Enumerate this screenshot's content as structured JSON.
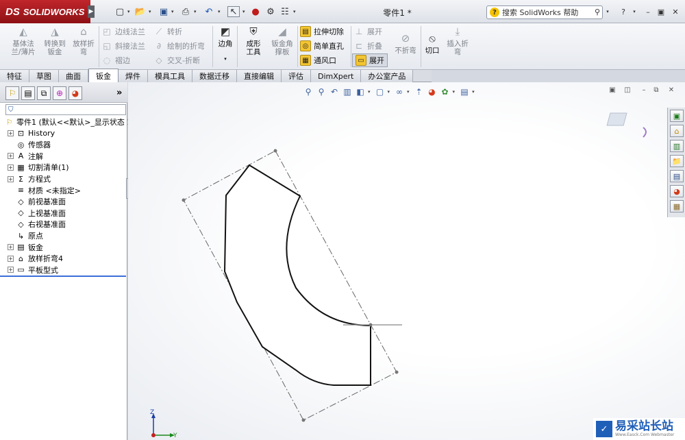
{
  "app": {
    "brand": "SOLIDWORKS",
    "brand_prefix": "DS",
    "doc_title": "零件1 *"
  },
  "search": {
    "placeholder": "搜索 SolidWorks 帮助"
  },
  "quick_access": [
    "new-icon",
    "open-icon",
    "save-icon",
    "print-icon",
    "undo-icon",
    "select-icon",
    "rebuild-icon",
    "options-icon",
    "display-icon"
  ],
  "ribbon": {
    "base_flange": "基体法兰/薄片",
    "convert_to_sheet": "转换到钣金",
    "lofted_bend": "放样折弯",
    "edge_flange": "边线法兰",
    "miter_flange": "斜接法兰",
    "hem": "褶边",
    "jog": "转折",
    "sketched_bend": "绘制的折弯",
    "cross_break": "交叉-折断",
    "corners": "边角",
    "forming_tool": "成形工具",
    "gusset": "钣金角撑板",
    "extruded_cut": "拉伸切除",
    "simple_hole": "简单直孔",
    "vent": "通风口",
    "unfold": "展开",
    "fold": "折叠",
    "flatten": "展开",
    "no_bends": "不折弯",
    "rip": "切口",
    "insert_bends": "插入折弯"
  },
  "tabs": [
    "特征",
    "草图",
    "曲面",
    "钣金",
    "焊件",
    "模具工具",
    "数据迁移",
    "直接编辑",
    "评估",
    "DimXpert",
    "办公室产品"
  ],
  "active_tab": "钣金",
  "tree": {
    "root": "零件1 (默认<<默认>_显示状态 1",
    "items": [
      {
        "label": "History",
        "expand": true
      },
      {
        "label": "传感器",
        "expand": false
      },
      {
        "label": "注解",
        "expand": true
      },
      {
        "label": "切割清单(1)",
        "expand": true
      },
      {
        "label": "方程式",
        "expand": true
      },
      {
        "label": "材质 <未指定>",
        "expand": false
      },
      {
        "label": "前视基准面",
        "expand": false
      },
      {
        "label": "上视基准面",
        "expand": false
      },
      {
        "label": "右视基准面",
        "expand": false
      },
      {
        "label": "原点",
        "expand": false
      },
      {
        "label": "钣金",
        "expand": true
      },
      {
        "label": "放样折弯4",
        "expand": true
      },
      {
        "label": "平板型式",
        "expand": true
      }
    ]
  },
  "triad": {
    "z": "Z",
    "y": "Y"
  },
  "watermark": {
    "cn": "易采站长站",
    "en": "Www.Easck.Com Webmaster"
  },
  "colors": {
    "brand_red": "#c0262b",
    "accent_yellow": "#f4c531",
    "tree_blue": "#3a6ed8"
  }
}
